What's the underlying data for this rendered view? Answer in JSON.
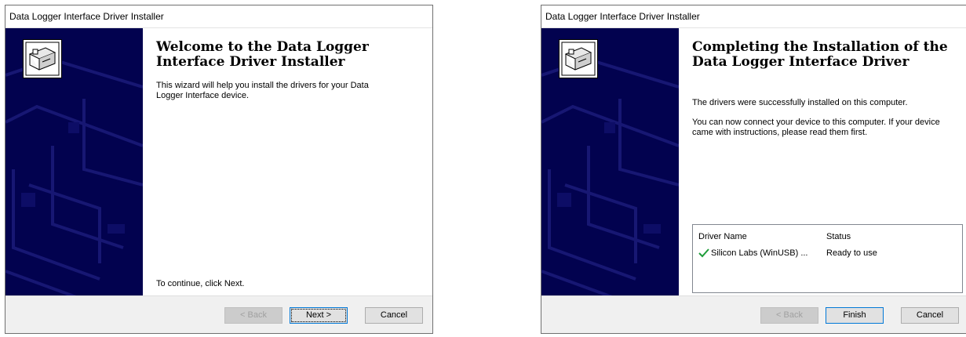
{
  "welcome": {
    "title": "Data Logger Interface Driver Installer",
    "heading_line1": "Welcome to the Data Logger",
    "heading_line2": "Interface Driver Installer",
    "intro_line1": "This wizard will help you install the drivers for your Data",
    "intro_line2": "Logger Interface device.",
    "continue_text": "To continue, click Next.",
    "buttons": {
      "back": "< Back",
      "next": "Next >",
      "cancel": "Cancel"
    }
  },
  "complete": {
    "title": "Data Logger Interface Driver Installer",
    "heading_line1": "Completing the Installation of the",
    "heading_line2": "Data Logger Interface Driver",
    "success_text": "The drivers were successfully installed on this computer.",
    "connect_line1": "You can now connect your device to this computer. If your device",
    "connect_line2": "came with instructions, please read them first.",
    "table": {
      "columns": [
        "Driver Name",
        "Status"
      ],
      "rows": [
        {
          "name": "Silicon Labs (WinUSB) ...",
          "status": "Ready to use"
        }
      ]
    },
    "buttons": {
      "back": "< Back",
      "finish": "Finish",
      "cancel": "Cancel"
    }
  },
  "colors": {
    "sidebar": "#02024f",
    "check": "#1f9d3a",
    "accent": "#0078d7"
  },
  "icons": {
    "sidebar_icon": "hardware-device-icon",
    "success": "checkmark-icon"
  }
}
